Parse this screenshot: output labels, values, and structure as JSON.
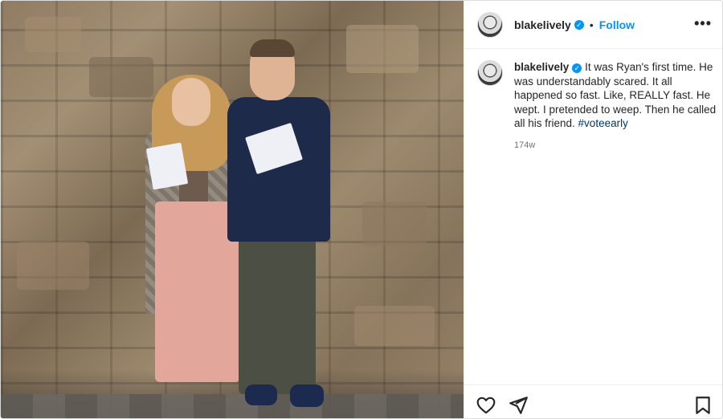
{
  "post": {
    "image_alt": "photo",
    "author": {
      "username": "blakelively",
      "verified_icon": "verified-badge-icon",
      "follow_label": "Follow",
      "separator": "•"
    },
    "caption": {
      "username": "blakelively",
      "text_before_tag": "It was Ryan's first time. He was understandably scared. It all happened so fast. Like, REALLY fast. He wept. I pretended to weep. Then he called all his friend. ",
      "hashtag": "#voteearly",
      "time": "174w"
    },
    "colors": {
      "follow": "#0095f6",
      "hashtag": "#00376b",
      "verified": "#0095f6"
    },
    "actions": {
      "like_icon": "heart-icon",
      "share_icon": "send-icon",
      "save_icon": "bookmark-icon"
    }
  }
}
